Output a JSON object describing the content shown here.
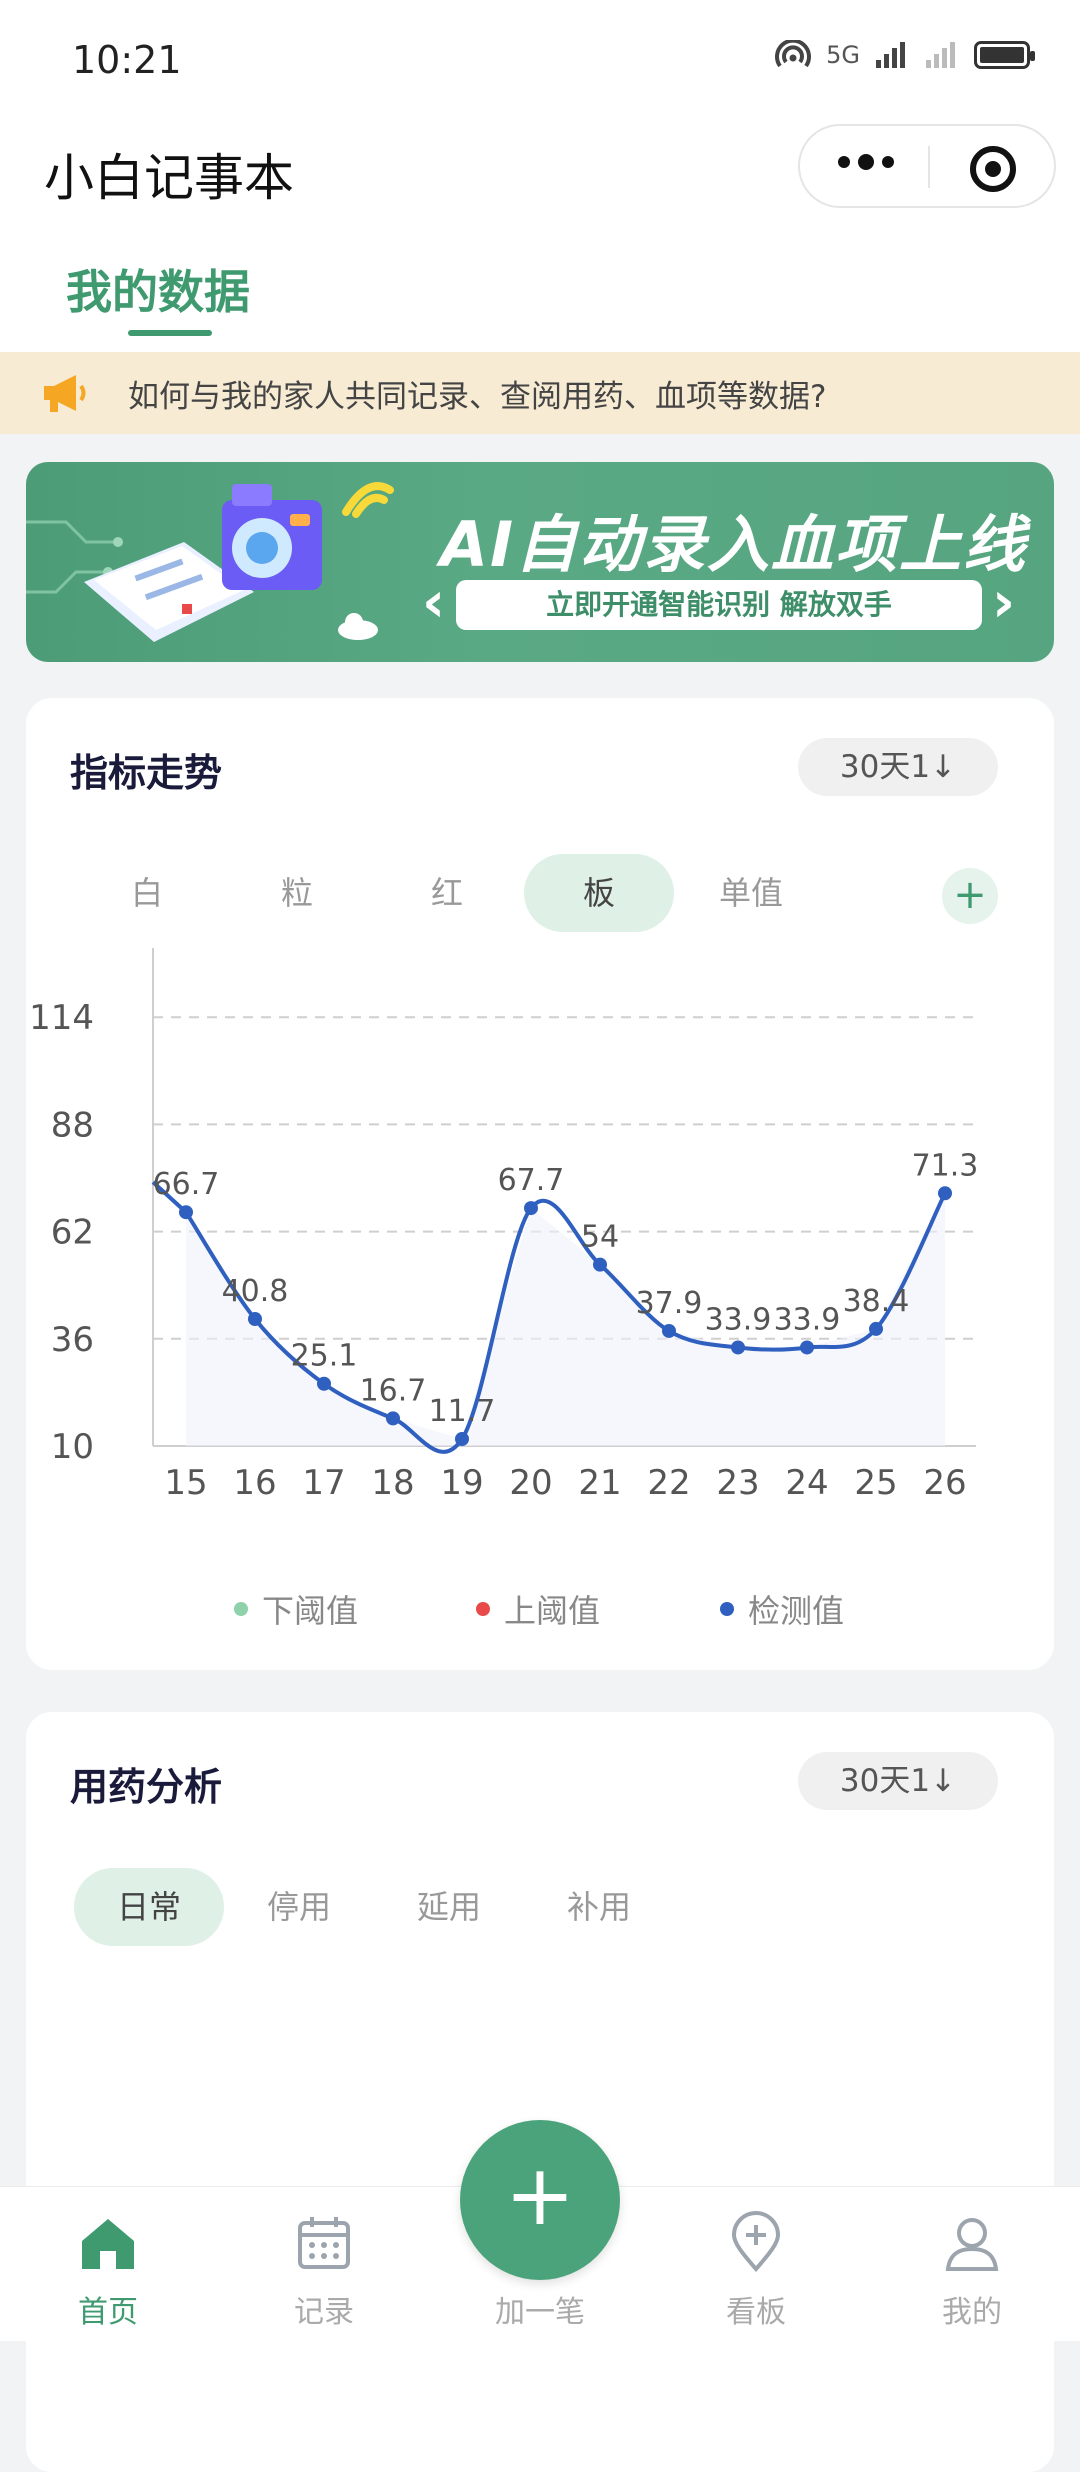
{
  "status_bar": {
    "time": "10:21",
    "network": "5G"
  },
  "app": {
    "title": "小白记事本"
  },
  "top_tab": {
    "label": "我的数据"
  },
  "notice": {
    "text": "如何与我的家人共同记录、查阅用药、血项等数据?"
  },
  "banner": {
    "title": "AI自动录入血项上线",
    "subtitle": "立即开通智能识别 解放双手"
  },
  "trend_card": {
    "title": "指标走势",
    "range_label": "30天1↓",
    "tabs": [
      {
        "label": "白",
        "active": false
      },
      {
        "label": "粒",
        "active": false
      },
      {
        "label": "红",
        "active": false
      },
      {
        "label": "板",
        "active": true
      },
      {
        "label": "单值",
        "active": false
      }
    ],
    "legend": [
      {
        "label": "下阈值",
        "color": "#8fd1a9"
      },
      {
        "label": "上阈值",
        "color": "#e84a4a"
      },
      {
        "label": "检测值",
        "color": "#2f5fbf"
      }
    ]
  },
  "chart_data": {
    "type": "line",
    "x": [
      "15",
      "16",
      "17",
      "18",
      "19",
      "20",
      "21",
      "22",
      "23",
      "24",
      "25",
      "26"
    ],
    "series": [
      {
        "name": "检测值",
        "values": [
          66.7,
          40.8,
          25.1,
          16.7,
          11.7,
          67.7,
          54,
          37.9,
          33.9,
          33.9,
          38.4,
          71.3
        ],
        "color": "#2f5fbf"
      }
    ],
    "yticks": [
      10,
      36,
      62,
      88,
      114,
      140
    ],
    "ylim": [
      10,
      140
    ],
    "grid": true,
    "legend_position": "bottom"
  },
  "medication_card": {
    "title": "用药分析",
    "range_label": "30天1↓",
    "tabs": [
      {
        "label": "日常",
        "active": true
      },
      {
        "label": "停用",
        "active": false
      },
      {
        "label": "延用",
        "active": false
      },
      {
        "label": "补用",
        "active": false
      }
    ]
  },
  "bottom_nav": {
    "items": [
      {
        "label": "首页",
        "icon": "home-icon",
        "active": true
      },
      {
        "label": "记录",
        "icon": "calendar-icon",
        "active": false
      },
      {
        "label": "加一笔",
        "icon": "plus-icon",
        "active": false
      },
      {
        "label": "看板",
        "icon": "location-plus-icon",
        "active": false
      },
      {
        "label": "我的",
        "icon": "user-icon",
        "active": false
      }
    ]
  },
  "colors": {
    "accent": "#3f9a70",
    "notice_bg": "#f7ebd4",
    "line": "#2f5fbf"
  }
}
